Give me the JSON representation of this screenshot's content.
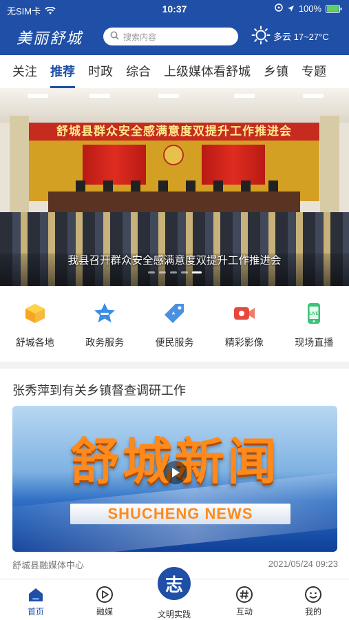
{
  "status_bar": {
    "carrier": "无SIM卡",
    "time": "10:37",
    "battery": "100%"
  },
  "app_bar": {
    "logo_text": "美丽舒城",
    "search_placeholder": "搜索内容",
    "weather": "多云 17~27°C"
  },
  "tabs": [
    {
      "label": "关注",
      "active": false
    },
    {
      "label": "推荐",
      "active": true
    },
    {
      "label": "时政",
      "active": false
    },
    {
      "label": "综合",
      "active": false
    },
    {
      "label": "上级媒体看舒城",
      "active": false
    },
    {
      "label": "乡镇",
      "active": false
    },
    {
      "label": "专题",
      "active": false
    }
  ],
  "banner": {
    "stage_banner_text": "舒城县群众安全感满意度双提升工作推进会",
    "caption": "我县召开群众安全感满意度双提升工作推进会",
    "slide_count": 5,
    "active_slide": 5
  },
  "shortcuts": [
    {
      "label": "舒城各地",
      "icon": "cube-icon",
      "color": "#f5a623"
    },
    {
      "label": "政务服务",
      "icon": "star-badge-icon",
      "color": "#3b8ee8"
    },
    {
      "label": "便民服务",
      "icon": "tag-icon",
      "color": "#4a90e2"
    },
    {
      "label": "精彩影像",
      "icon": "video-camera-icon",
      "color": "#e8473d"
    },
    {
      "label": "现场直播",
      "icon": "live-phone-icon",
      "color": "#3cc27a"
    }
  ],
  "news_card": {
    "title": "张秀萍到有关乡镇督查调研工作",
    "thumb_title": "舒城新闻",
    "thumb_subtitle": "SHUCHENG NEWS",
    "source": "舒城县融媒体中心",
    "time": "2021/05/24 09:23"
  },
  "bottom_nav": {
    "items": [
      {
        "label": "首页",
        "icon": "home-icon",
        "active": true
      },
      {
        "label": "融媒",
        "icon": "play-circle-icon",
        "active": false
      },
      {
        "label": "文明实践",
        "icon": "zhi-logo-icon",
        "active": false
      },
      {
        "label": "互动",
        "icon": "hashtag-icon",
        "active": false
      },
      {
        "label": "我的",
        "icon": "smiley-icon",
        "active": false
      }
    ],
    "center_glyph": "志"
  },
  "colors": {
    "brand_blue": "#1f4fa6",
    "banner_red": "#c52b1f"
  }
}
